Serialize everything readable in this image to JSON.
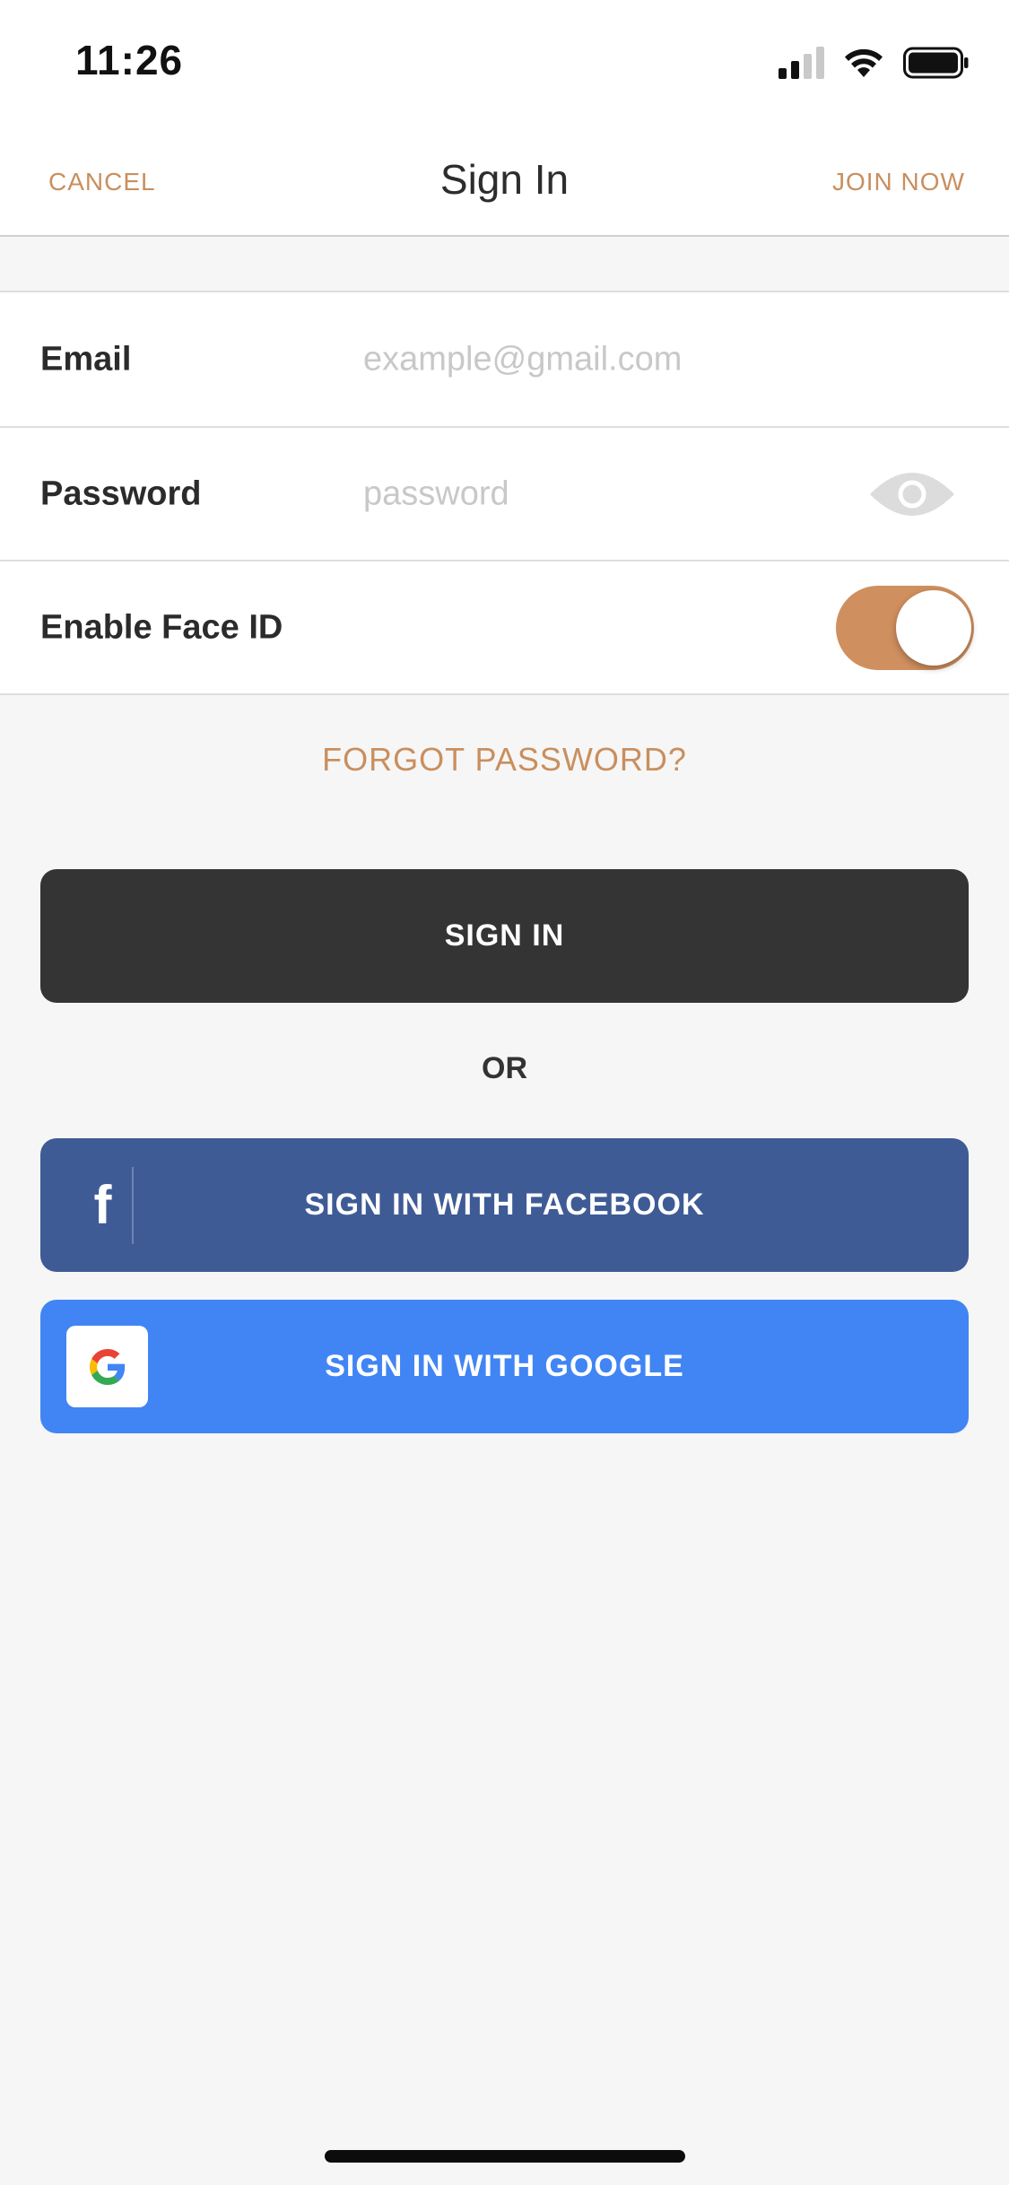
{
  "status_bar": {
    "time": "11:26"
  },
  "nav": {
    "cancel_label": "CANCEL",
    "title": "Sign In",
    "join_label": "JOIN NOW"
  },
  "form": {
    "email": {
      "label": "Email",
      "value": "",
      "placeholder": "example@gmail.com"
    },
    "password": {
      "label": "Password",
      "value": "",
      "placeholder": "password"
    },
    "face_id": {
      "label": "Enable Face ID",
      "enabled": true
    }
  },
  "forgot_password_label": "FORGOT PASSWORD?",
  "sign_in_label": "SIGN IN",
  "or_label": "OR",
  "facebook": {
    "label": "SIGN IN WITH FACEBOOK",
    "icon_glyph": "f"
  },
  "google": {
    "label": "SIGN IN WITH GOOGLE"
  },
  "colors": {
    "accent": "#c98f5e",
    "toggle_on": "#d08f5e",
    "sign_in_button": "#343434",
    "facebook_button": "#3e5b96",
    "google_button": "#4185f4",
    "background": "#f6f6f6"
  },
  "icons": {
    "signal": "cellular-signal-icon",
    "wifi": "wifi-icon",
    "battery": "battery-icon",
    "password_visibility": "eye-icon",
    "facebook": "facebook-icon",
    "google": "google-icon"
  }
}
